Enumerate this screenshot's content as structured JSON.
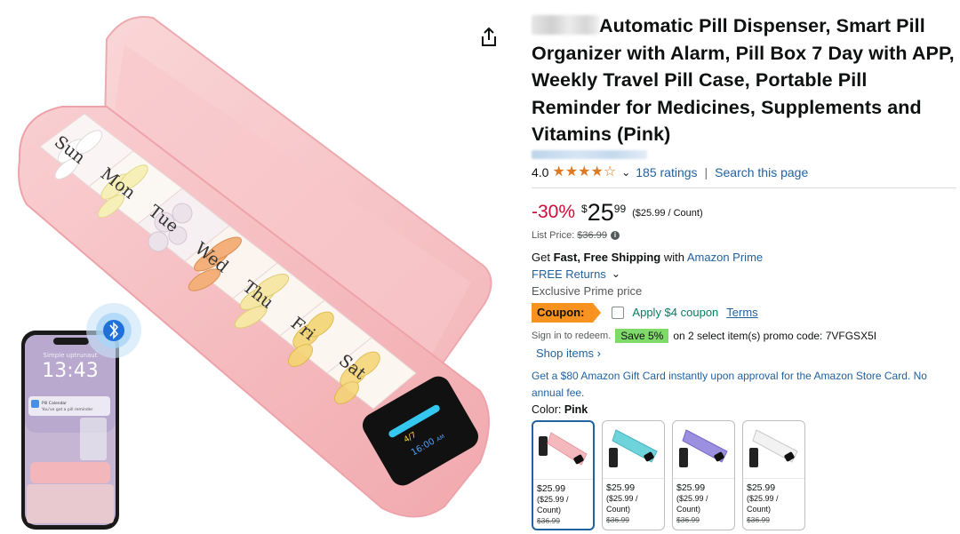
{
  "product": {
    "title_text": "Automatic Pill Dispenser, Smart Pill Organizer with Alarm, Pill Box 7 Day with APP, Weekly Travel Pill Case, Portable Pill Reminder for Medicines, Supplements and Vitamins (Pink)",
    "rating_value": "4.0",
    "ratings_count": "185 ratings",
    "search_page": "Search this page"
  },
  "price": {
    "discount": "-30%",
    "symbol": "$",
    "whole": "25",
    "fraction": "99",
    "per_unit": "($25.99 / Count)",
    "list_label": "List Price:",
    "list_value": "$36.99"
  },
  "shipping": {
    "get": "Get",
    "fast": "Fast, Free Shipping",
    "with": "with",
    "prime": "Amazon Prime",
    "returns": "FREE Returns",
    "exclusive": "Exclusive Prime price"
  },
  "coupon": {
    "badge": "Coupon:",
    "text": "Apply $4 coupon",
    "terms": "Terms"
  },
  "promo": {
    "signin": "Sign in to redeem.",
    "save": "Save 5%",
    "text": "on 2 select item(s) promo code: 7VFGSX5I",
    "shop": "Shop items ›"
  },
  "gift_card": "Get a $80 Amazon Gift Card instantly upon approval for the Amazon Store Card. No annual fee.",
  "color": {
    "label": "Color:",
    "value": "Pink"
  },
  "swatches": [
    {
      "price": "$25.99",
      "unit": "($25.99 / Count)",
      "list": "$36.99",
      "color": "#f4b9bd"
    },
    {
      "price": "$25.99",
      "unit": "($25.99 / Count)",
      "list": "$36.99",
      "color": "#6fd3dc"
    },
    {
      "price": "$25.99",
      "unit": "($25.99 / Count)",
      "list": "$36.99",
      "color": "#9b8fe0"
    },
    {
      "price": "$25.99",
      "unit": "($25.99 / Count)",
      "list": "$36.99",
      "color": "#f2f2f2"
    }
  ],
  "image": {
    "days": [
      "Sun",
      "Mon",
      "Tue",
      "Wed",
      "Thu",
      "Fri",
      "Sat"
    ],
    "phone_time": "13:43",
    "phone_top": "Simple uptrunaut",
    "phone_notice_title": "Pill Calendar",
    "phone_notice_body": "You've got a pill reminder",
    "screen_count": "4/7",
    "screen_time": "16:00",
    "screen_ampm": "AM"
  },
  "colors": {
    "accent": "#2162a1",
    "deal": "#cc0c39",
    "coupon": "#f7931e",
    "save": "#7fda69",
    "star": "#de7921",
    "device": "#f4b5b8"
  }
}
